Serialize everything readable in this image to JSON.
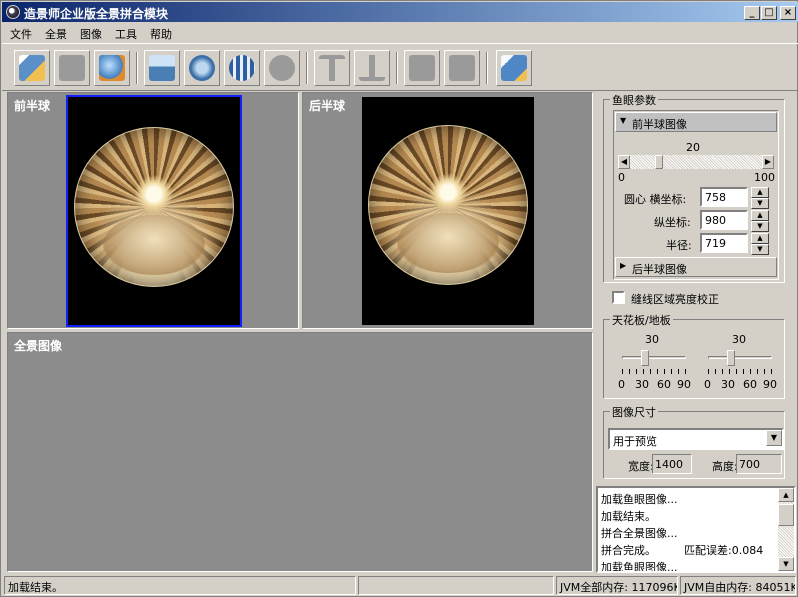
{
  "window": {
    "title": "造景师企业版全景拼合模块",
    "minimize": "_",
    "maximize": "□",
    "close": "×"
  },
  "menu": [
    "文件",
    "全景",
    "图像",
    "工具",
    "帮助"
  ],
  "toolbar": {
    "buttons": [
      {
        "icon": "open-folder-icon",
        "enabled": true,
        "color": "#5a8fc8"
      },
      {
        "icon": "blank-icon",
        "enabled": false
      },
      {
        "icon": "globe-export-icon",
        "enabled": true,
        "color": "#3f7fbf"
      },
      {
        "icon": "image-load-icon",
        "enabled": true,
        "color": "#4a7fb5"
      },
      {
        "icon": "globe-arrow-icon",
        "enabled": true,
        "color": "#3a6fa8"
      },
      {
        "icon": "sphere-icon",
        "enabled": true,
        "color": "#2f5f9f"
      },
      {
        "icon": "sphere-gray-icon",
        "enabled": false
      },
      {
        "icon": "upload-icon",
        "enabled": false
      },
      {
        "icon": "download-icon",
        "enabled": false
      },
      {
        "icon": "page-icon",
        "enabled": false
      },
      {
        "icon": "page-edit-icon",
        "enabled": false
      },
      {
        "icon": "help-book-icon",
        "enabled": true,
        "color": "#4f86c6"
      }
    ]
  },
  "panels": {
    "front_label": "前半球",
    "back_label": "后半球",
    "pano_label": "全景图像"
  },
  "fisheye_params": {
    "title": "鱼眼参数",
    "front_section": "前半球图像",
    "slider_value": "20",
    "slider_min": "0",
    "slider_max": "100",
    "slider_fraction": 0.2,
    "center_x_label": "圆心 横坐标:",
    "center_x": "758",
    "center_y_label": "纵坐标:",
    "center_y": "980",
    "radius_label": "半径:",
    "radius": "719",
    "back_section": "后半球图像"
  },
  "seam_checkbox": {
    "label": "缝线区域亮度校正",
    "checked": false
  },
  "ceiling_floor": {
    "title": "天花板/地板",
    "left_value": "30",
    "right_value": "30",
    "left_fraction": 0.333,
    "right_fraction": 0.333,
    "ticks": [
      "0",
      "30",
      "60",
      "90"
    ]
  },
  "image_size": {
    "title": "图像尺寸",
    "preset": "用于预览",
    "width_label": "宽度:",
    "width": "1400",
    "height_label": "高度:",
    "height": "700"
  },
  "log": {
    "lines": [
      "加载鱼眼图像...",
      "加载结束。",
      "拼合全景图像...",
      "拼合完成。",
      "加载鱼眼图像..."
    ],
    "match_error": "匹配误差:0.084"
  },
  "status": {
    "message": "加载结束。",
    "total_memory": "JVM全部内存: 117096K",
    "free_memory": "JVM自由内存: 84051K"
  }
}
